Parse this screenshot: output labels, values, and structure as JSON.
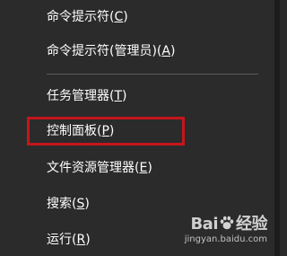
{
  "menu": {
    "items": [
      {
        "label_pre": "命令提示符(",
        "key": "C",
        "label_post": ")"
      },
      {
        "label_pre": "命令提示符(管理员)(",
        "key": "A",
        "label_post": ")"
      },
      {
        "label_pre": "任务管理器(",
        "key": "T",
        "label_post": ")"
      },
      {
        "label_pre": "控制面板(",
        "key": "P",
        "label_post": ")"
      },
      {
        "label_pre": "文件资源管理器(",
        "key": "E",
        "label_post": ")"
      },
      {
        "label_pre": "搜索(",
        "key": "S",
        "label_post": ")"
      },
      {
        "label_pre": "运行(",
        "key": "R",
        "label_post": ")"
      }
    ]
  },
  "highlight": {
    "target": "控制面板(P)",
    "color": "#c4161c"
  },
  "watermark": {
    "logo_left": "Bai",
    "logo_right": "经验",
    "sub": "jingyan.baidu.com",
    "icon": "paw-icon"
  },
  "colors": {
    "menu_background": "#2b2b2b",
    "text": "#ffffff",
    "separator": "#5a5a5a"
  }
}
